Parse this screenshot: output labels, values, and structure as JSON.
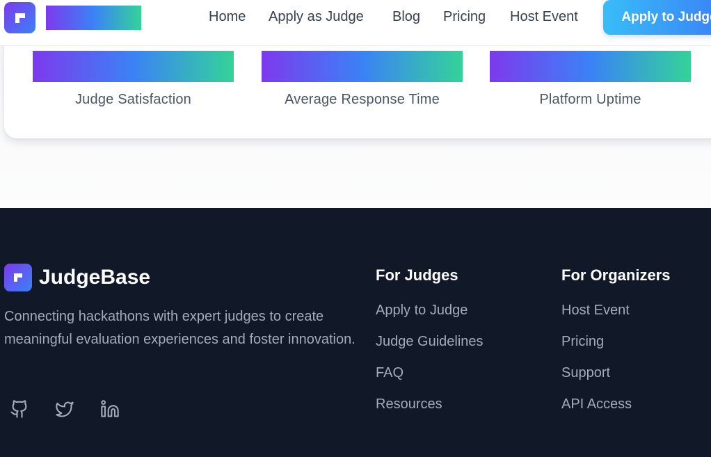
{
  "header": {
    "nav": [
      "Home",
      "Apply as Judge",
      "Blog",
      "Pricing",
      "Host Event"
    ],
    "cta_label": "Apply to Judge"
  },
  "stats": [
    {
      "label": "Judge Satisfaction"
    },
    {
      "label": "Average Response Time"
    },
    {
      "label": "Platform Uptime"
    }
  ],
  "footer": {
    "brand": "JudgeBase",
    "description": "Connecting hackathons with expert judges to create meaningful evaluation experiences and foster innovation.",
    "social_icons": [
      "github-icon",
      "twitter-icon",
      "linkedin-icon"
    ],
    "columns": [
      {
        "title": "For Judges",
        "links": [
          "Apply to Judge",
          "Judge Guidelines",
          "FAQ",
          "Resources"
        ]
      },
      {
        "title": "For Organizers",
        "links": [
          "Host Event",
          "Pricing",
          "Support",
          "API Access"
        ]
      }
    ]
  },
  "colors": {
    "accent_gradient": [
      "#7c3aed",
      "#3b82f6",
      "#34d399"
    ],
    "cta_gradient": [
      "#38bdf8",
      "#3b82f6"
    ],
    "footer_bg": "#111827"
  }
}
